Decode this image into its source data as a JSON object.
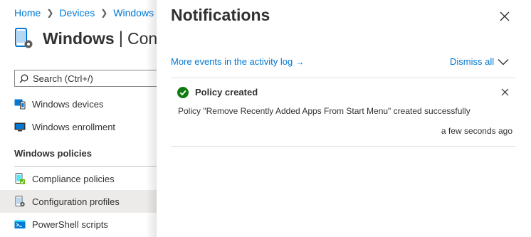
{
  "breadcrumb": {
    "items": [
      "Home",
      "Devices",
      "Windows"
    ]
  },
  "blade": {
    "title": "Windows",
    "subtitle": "Con"
  },
  "search": {
    "placeholder": "Search (Ctrl+/)"
  },
  "nav": {
    "top_items": [
      {
        "label": "Windows devices",
        "icon": "windows-devices-icon"
      },
      {
        "label": "Windows enrollment",
        "icon": "windows-enrollment-icon"
      }
    ],
    "section_title": "Windows policies",
    "policy_items": [
      {
        "label": "Compliance policies",
        "icon": "compliance-policies-icon"
      },
      {
        "label": "Configuration profiles",
        "icon": "configuration-profiles-icon",
        "selected": true
      },
      {
        "label": "PowerShell scripts",
        "icon": "powershell-scripts-icon"
      }
    ]
  },
  "notifications": {
    "title": "Notifications",
    "activity_link": "More events in the activity log",
    "dismiss_all": "Dismiss all",
    "items": [
      {
        "status": "success",
        "title": "Policy created",
        "message": "Policy \"Remove Recently Added Apps From Start Menu\" created successfully",
        "time": "a few seconds ago"
      }
    ]
  },
  "colors": {
    "accent": "#0078d4",
    "success": "#107c10",
    "text": "#323130",
    "selected_bg": "#edebe9"
  }
}
